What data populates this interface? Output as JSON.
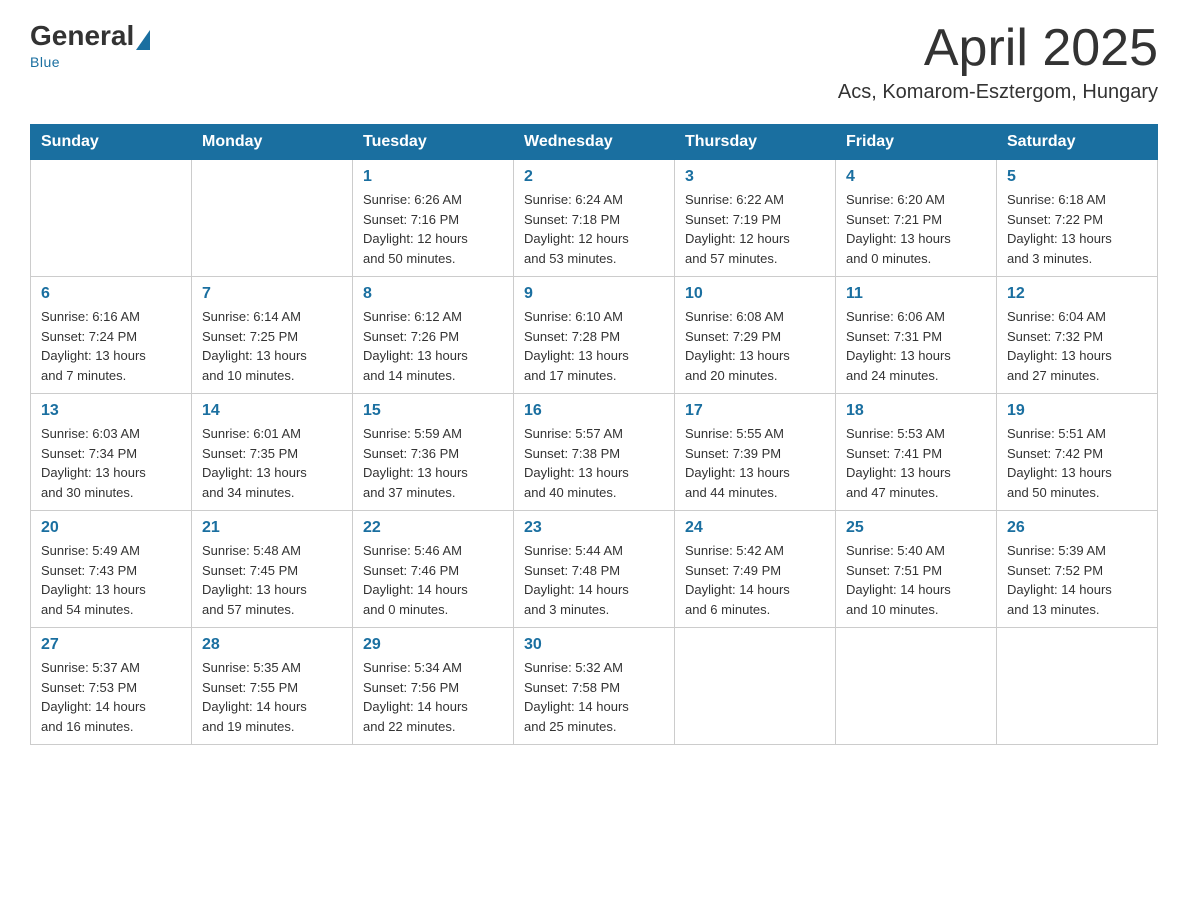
{
  "header": {
    "logo_general": "General",
    "logo_blue": "Blue",
    "month_title": "April 2025",
    "location": "Acs, Komarom-Esztergom, Hungary"
  },
  "weekdays": [
    "Sunday",
    "Monday",
    "Tuesday",
    "Wednesday",
    "Thursday",
    "Friday",
    "Saturday"
  ],
  "weeks": [
    [
      {
        "day": "",
        "info": ""
      },
      {
        "day": "",
        "info": ""
      },
      {
        "day": "1",
        "info": "Sunrise: 6:26 AM\nSunset: 7:16 PM\nDaylight: 12 hours\nand 50 minutes."
      },
      {
        "day": "2",
        "info": "Sunrise: 6:24 AM\nSunset: 7:18 PM\nDaylight: 12 hours\nand 53 minutes."
      },
      {
        "day": "3",
        "info": "Sunrise: 6:22 AM\nSunset: 7:19 PM\nDaylight: 12 hours\nand 57 minutes."
      },
      {
        "day": "4",
        "info": "Sunrise: 6:20 AM\nSunset: 7:21 PM\nDaylight: 13 hours\nand 0 minutes."
      },
      {
        "day": "5",
        "info": "Sunrise: 6:18 AM\nSunset: 7:22 PM\nDaylight: 13 hours\nand 3 minutes."
      }
    ],
    [
      {
        "day": "6",
        "info": "Sunrise: 6:16 AM\nSunset: 7:24 PM\nDaylight: 13 hours\nand 7 minutes."
      },
      {
        "day": "7",
        "info": "Sunrise: 6:14 AM\nSunset: 7:25 PM\nDaylight: 13 hours\nand 10 minutes."
      },
      {
        "day": "8",
        "info": "Sunrise: 6:12 AM\nSunset: 7:26 PM\nDaylight: 13 hours\nand 14 minutes."
      },
      {
        "day": "9",
        "info": "Sunrise: 6:10 AM\nSunset: 7:28 PM\nDaylight: 13 hours\nand 17 minutes."
      },
      {
        "day": "10",
        "info": "Sunrise: 6:08 AM\nSunset: 7:29 PM\nDaylight: 13 hours\nand 20 minutes."
      },
      {
        "day": "11",
        "info": "Sunrise: 6:06 AM\nSunset: 7:31 PM\nDaylight: 13 hours\nand 24 minutes."
      },
      {
        "day": "12",
        "info": "Sunrise: 6:04 AM\nSunset: 7:32 PM\nDaylight: 13 hours\nand 27 minutes."
      }
    ],
    [
      {
        "day": "13",
        "info": "Sunrise: 6:03 AM\nSunset: 7:34 PM\nDaylight: 13 hours\nand 30 minutes."
      },
      {
        "day": "14",
        "info": "Sunrise: 6:01 AM\nSunset: 7:35 PM\nDaylight: 13 hours\nand 34 minutes."
      },
      {
        "day": "15",
        "info": "Sunrise: 5:59 AM\nSunset: 7:36 PM\nDaylight: 13 hours\nand 37 minutes."
      },
      {
        "day": "16",
        "info": "Sunrise: 5:57 AM\nSunset: 7:38 PM\nDaylight: 13 hours\nand 40 minutes."
      },
      {
        "day": "17",
        "info": "Sunrise: 5:55 AM\nSunset: 7:39 PM\nDaylight: 13 hours\nand 44 minutes."
      },
      {
        "day": "18",
        "info": "Sunrise: 5:53 AM\nSunset: 7:41 PM\nDaylight: 13 hours\nand 47 minutes."
      },
      {
        "day": "19",
        "info": "Sunrise: 5:51 AM\nSunset: 7:42 PM\nDaylight: 13 hours\nand 50 minutes."
      }
    ],
    [
      {
        "day": "20",
        "info": "Sunrise: 5:49 AM\nSunset: 7:43 PM\nDaylight: 13 hours\nand 54 minutes."
      },
      {
        "day": "21",
        "info": "Sunrise: 5:48 AM\nSunset: 7:45 PM\nDaylight: 13 hours\nand 57 minutes."
      },
      {
        "day": "22",
        "info": "Sunrise: 5:46 AM\nSunset: 7:46 PM\nDaylight: 14 hours\nand 0 minutes."
      },
      {
        "day": "23",
        "info": "Sunrise: 5:44 AM\nSunset: 7:48 PM\nDaylight: 14 hours\nand 3 minutes."
      },
      {
        "day": "24",
        "info": "Sunrise: 5:42 AM\nSunset: 7:49 PM\nDaylight: 14 hours\nand 6 minutes."
      },
      {
        "day": "25",
        "info": "Sunrise: 5:40 AM\nSunset: 7:51 PM\nDaylight: 14 hours\nand 10 minutes."
      },
      {
        "day": "26",
        "info": "Sunrise: 5:39 AM\nSunset: 7:52 PM\nDaylight: 14 hours\nand 13 minutes."
      }
    ],
    [
      {
        "day": "27",
        "info": "Sunrise: 5:37 AM\nSunset: 7:53 PM\nDaylight: 14 hours\nand 16 minutes."
      },
      {
        "day": "28",
        "info": "Sunrise: 5:35 AM\nSunset: 7:55 PM\nDaylight: 14 hours\nand 19 minutes."
      },
      {
        "day": "29",
        "info": "Sunrise: 5:34 AM\nSunset: 7:56 PM\nDaylight: 14 hours\nand 22 minutes."
      },
      {
        "day": "30",
        "info": "Sunrise: 5:32 AM\nSunset: 7:58 PM\nDaylight: 14 hours\nand 25 minutes."
      },
      {
        "day": "",
        "info": ""
      },
      {
        "day": "",
        "info": ""
      },
      {
        "day": "",
        "info": ""
      }
    ]
  ]
}
